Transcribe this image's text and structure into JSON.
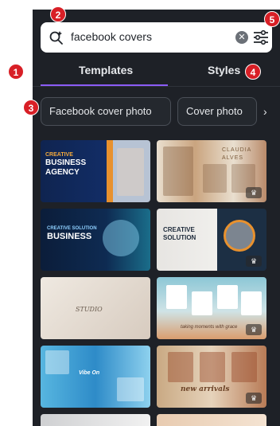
{
  "search": {
    "query": "facebook covers",
    "clear_glyph": "✕",
    "search_icon": "magic-search-icon",
    "filter_icon": "sliders-icon"
  },
  "tabs": [
    {
      "label": "Templates",
      "active": true
    },
    {
      "label": "Styles",
      "active": false
    }
  ],
  "chips": [
    {
      "label": "Facebook cover photo"
    },
    {
      "label": "Cover photo"
    }
  ],
  "chip_arrow": "›",
  "templates": [
    {
      "id": "t1",
      "lines": [
        "CREATIVE",
        "BUSINESS",
        "AGENCY"
      ],
      "premium": false
    },
    {
      "id": "t2",
      "lines": [
        "CLAUDIA ALVES"
      ],
      "premium": true
    },
    {
      "id": "t3",
      "lines": [
        "CREATIVE SOLUTION",
        "BUSINESS"
      ],
      "premium": false
    },
    {
      "id": "t4",
      "lines": [
        "CREATIVE",
        "SOLUTION"
      ],
      "premium": true
    },
    {
      "id": "t5",
      "lines": [
        "STUDIO"
      ],
      "premium": false
    },
    {
      "id": "t6",
      "lines": [
        "taking moments with grace"
      ],
      "premium": true
    },
    {
      "id": "t7",
      "lines": [
        "Vibe On"
      ],
      "premium": false
    },
    {
      "id": "t8",
      "lines": [
        "new arrivals"
      ],
      "premium": true
    }
  ],
  "premium_glyph": "♛",
  "callouts": [
    "1",
    "2",
    "3",
    "4",
    "5"
  ],
  "colors": {
    "panel_bg": "#1e2127",
    "accent": "#8b5cf6",
    "callout_red": "#d81f26"
  }
}
